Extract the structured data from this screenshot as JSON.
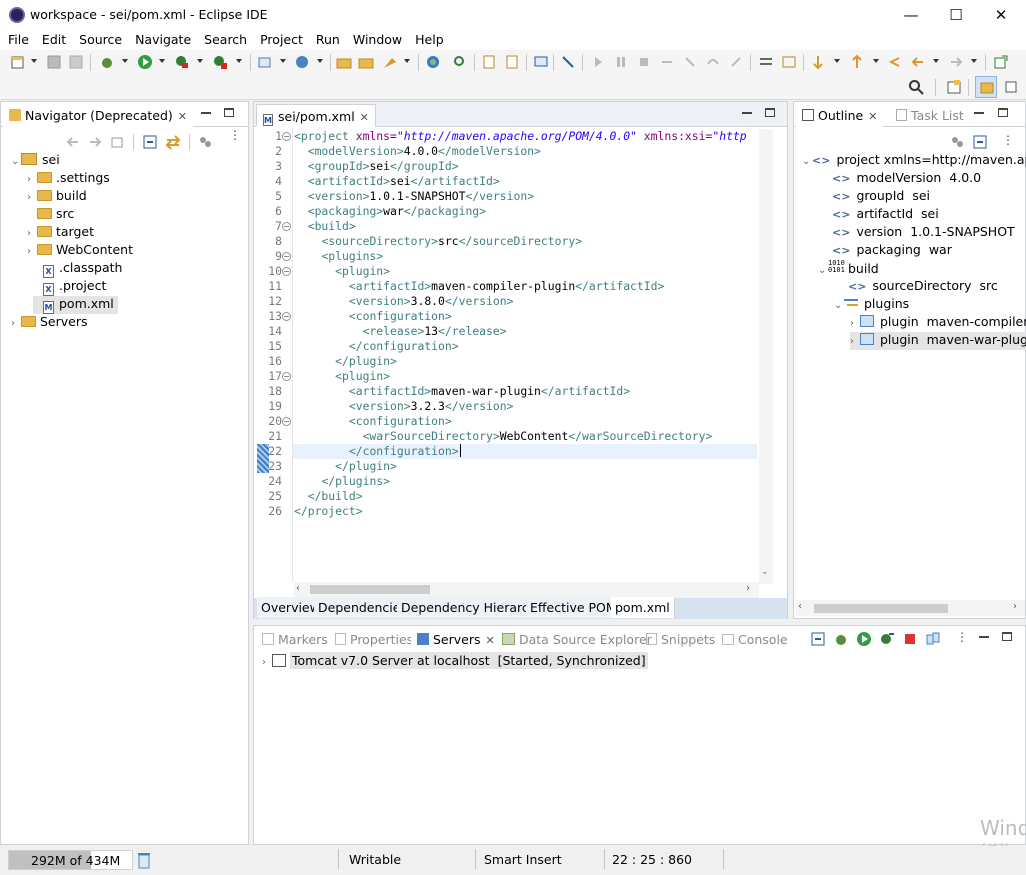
{
  "window": {
    "title": "workspace - sei/pom.xml - Eclipse IDE",
    "controls": {
      "minimize": "—",
      "maximize": "☐",
      "close": "✕"
    }
  },
  "menu": [
    "File",
    "Edit",
    "Source",
    "Navigate",
    "Search",
    "Project",
    "Run",
    "Window",
    "Help"
  ],
  "navigator": {
    "tab_label": "Navigator (Deprecated)",
    "project": "sei",
    "items": [
      ".settings",
      "build",
      "src",
      "target",
      "WebContent",
      ".classpath",
      ".project",
      "pom.xml"
    ],
    "servers": "Servers",
    "selected": "pom.xml"
  },
  "editor": {
    "tab_label": "sei/pom.xml",
    "lines": [
      "1",
      "2",
      "3",
      "4",
      "5",
      "6",
      "7",
      "8",
      "9",
      "10",
      "11",
      "12",
      "13",
      "14",
      "15",
      "16",
      "17",
      "18",
      "19",
      "20",
      "21",
      "22",
      "23",
      "24",
      "25",
      "26"
    ],
    "code": [
      {
        "t": "<project",
        "a1": "xmlns=",
        "v1": "\"http://maven.apache.org/POM/4.0.0\"",
        "a2": "xmlns:xsi=",
        "v2": "\"http"
      },
      {
        "open": "<modelVersion>",
        "text": "4.0.0",
        "close": "</modelVersion>"
      },
      {
        "open": "<groupId>",
        "text": "sei",
        "close": "</groupId>"
      },
      {
        "open": "<artifactId>",
        "text": "sei",
        "close": "</artifactId>"
      },
      {
        "open": "<version>",
        "text": "1.0.1-SNAPSHOT",
        "close": "</version>"
      },
      {
        "open": "<packaging>",
        "text": "war",
        "close": "</packaging>"
      },
      {
        "open": "<build>",
        "text": "",
        "close": ""
      },
      {
        "open": "<sourceDirectory>",
        "text": "src",
        "close": "</sourceDirectory>"
      },
      {
        "open": "<plugins>",
        "text": "",
        "close": ""
      },
      {
        "open": "<plugin>",
        "text": "",
        "close": ""
      },
      {
        "open": "<artifactId>",
        "text": "maven-compiler-plugin",
        "close": "</artifactId>"
      },
      {
        "open": "<version>",
        "text": "3.8.0",
        "close": "</version>"
      },
      {
        "open": "<configuration>",
        "text": "",
        "close": ""
      },
      {
        "open": "<release>",
        "text": "13",
        "close": "</release>"
      },
      {
        "open": "</configuration>",
        "text": "",
        "close": ""
      },
      {
        "open": "</plugin>",
        "text": "",
        "close": ""
      },
      {
        "open": "<plugin>",
        "text": "",
        "close": ""
      },
      {
        "open": "<artifactId>",
        "text": "maven-war-plugin",
        "close": "</artifactId>"
      },
      {
        "open": "<version>",
        "text": "3.2.3",
        "close": "</version>"
      },
      {
        "open": "<configuration>",
        "text": "",
        "close": ""
      },
      {
        "open": "<warSourceDirectory>",
        "text": "WebContent",
        "close": "</warSourceDirectory>"
      },
      {
        "open": "</configuration>",
        "text": "",
        "close": ""
      },
      {
        "open": "</plugin>",
        "text": "",
        "close": ""
      },
      {
        "open": "</plugins>",
        "text": "",
        "close": ""
      },
      {
        "open": "</build>",
        "text": "",
        "close": ""
      },
      {
        "open": "</project>",
        "text": "",
        "close": ""
      }
    ],
    "bottom_tabs": [
      "Overview",
      "Dependencies",
      "Dependency Hierarchy",
      "Effective POM",
      "pom.xml"
    ],
    "active_bottom_tab": "pom.xml"
  },
  "outline": {
    "tab_label": "Outline",
    "task_tab": "Task List",
    "root": "project xmlns=http://maven.apach",
    "nodes": {
      "modelVersion": {
        "name": "modelVersion",
        "value": "4.0.0"
      },
      "groupId": {
        "name": "groupId",
        "value": "sei"
      },
      "artifactId": {
        "name": "artifactId",
        "value": "sei"
      },
      "version": {
        "name": "version",
        "value": "1.0.1-SNAPSHOT"
      },
      "packaging": {
        "name": "packaging",
        "value": "war"
      },
      "build": {
        "name": "build"
      },
      "sourceDirectory": {
        "name": "sourceDirectory",
        "value": "src"
      },
      "plugins": {
        "name": "plugins"
      },
      "plugin1": {
        "name": "plugin",
        "value": "maven-compiler-"
      },
      "plugin2": {
        "name": "plugin",
        "value": "maven-war-plugi"
      }
    }
  },
  "bottom_panel": {
    "tabs": [
      "Markers",
      "Properties",
      "Servers",
      "Data Source Explorer",
      "Snippets",
      "Console"
    ],
    "active": "Servers",
    "server": "Tomcat v7.0 Server at localhost",
    "server_state": "[Started, Synchronized]"
  },
  "status": {
    "heap": "292M of 434M",
    "heap_fraction": 0.67,
    "writable": "Writable",
    "insert_mode": "Smart Insert",
    "position": "22 : 25 : 860"
  },
  "watermark": "Wind",
  "watermark_sub": "[설정"
}
